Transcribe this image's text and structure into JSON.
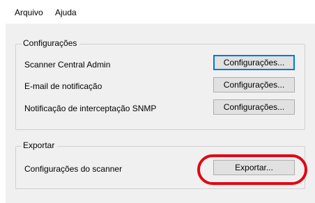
{
  "menu": {
    "items": [
      {
        "label": "Arquivo"
      },
      {
        "label": "Ajuda"
      }
    ]
  },
  "settings_group": {
    "title": "Configurações",
    "rows": [
      {
        "label": "Scanner Central Admin",
        "button": "Configurações..."
      },
      {
        "label": "E-mail de notificação",
        "button": "Configurações..."
      },
      {
        "label": "Notificação de interceptação SNMP",
        "button": "Configurações..."
      }
    ]
  },
  "export_group": {
    "title": "Exportar",
    "row_label": "Configurações do scanner",
    "button": "Exportar..."
  },
  "colors": {
    "highlight": "#e30613",
    "focus_border": "#0078d7",
    "panel_background": "#f0f0f0"
  }
}
